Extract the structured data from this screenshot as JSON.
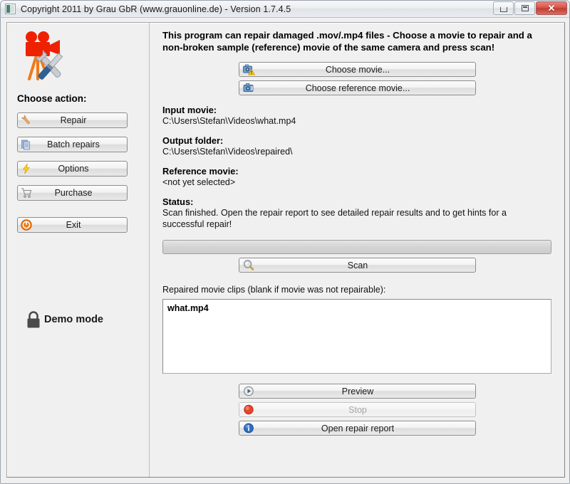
{
  "window": {
    "title": "Copyright 2011 by Grau GbR (www.grauonline.de) - Version 1.7.4.5",
    "icon": "app-icon",
    "controls": {
      "minimize": "minimize-button",
      "maximize": "maximize-button",
      "close": "close-button"
    }
  },
  "sidebar": {
    "logo_icon": "movie-repair-logo-icon",
    "heading": "Choose action:",
    "buttons": [
      {
        "label": "Repair",
        "icon": "wrench-icon"
      },
      {
        "label": "Batch repairs",
        "icon": "documents-icon"
      },
      {
        "label": "Options",
        "icon": "lightning-icon"
      },
      {
        "label": "Purchase",
        "icon": "shopping-cart-icon"
      },
      {
        "label": "Exit",
        "icon": "power-icon"
      }
    ],
    "demo_mode": {
      "label": "Demo mode",
      "icon": "padlock-icon"
    }
  },
  "main": {
    "headline": "This program can repair damaged .mov/.mp4 files - Choose a movie to repair and a non-broken sample (reference) movie of the same camera and press scan!",
    "choose_buttons": [
      {
        "label": "Choose movie...",
        "icon": "camera-warning-icon",
        "disabled": false
      },
      {
        "label": "Choose reference movie...",
        "icon": "camera-icon",
        "disabled": false
      }
    ],
    "fields": [
      {
        "title": "Input movie:",
        "value": "C:\\Users\\Stefan\\Videos\\what.mp4"
      },
      {
        "title": "Output folder:",
        "value": "C:\\Users\\Stefan\\Videos\\repaired\\"
      },
      {
        "title": "Reference movie:",
        "value": "<not yet selected>"
      }
    ],
    "status": {
      "title": "Status:",
      "text": "Scan finished. Open the repair report to see detailed repair results and to get hints for a successful repair!"
    },
    "progress": {
      "value": 0,
      "max": 100
    },
    "scan_button": {
      "label": "Scan",
      "icon": "magnifier-icon",
      "disabled": false
    },
    "list_caption": "Repaired movie clips (blank if movie was not repairable):",
    "clips": [
      "what.mp4"
    ],
    "bottom_buttons": [
      {
        "label": "Preview",
        "icon": "play-circle-icon",
        "disabled": false
      },
      {
        "label": "Stop",
        "icon": "stop-circle-icon",
        "disabled": true
      },
      {
        "label": "Open repair report",
        "icon": "info-circle-icon",
        "disabled": false
      }
    ]
  },
  "colors": {
    "accent_red": "#ee2200",
    "tripod_orange": "#f07a18",
    "close_button": "#c43a30",
    "window_bg": "#f0f0f0"
  }
}
